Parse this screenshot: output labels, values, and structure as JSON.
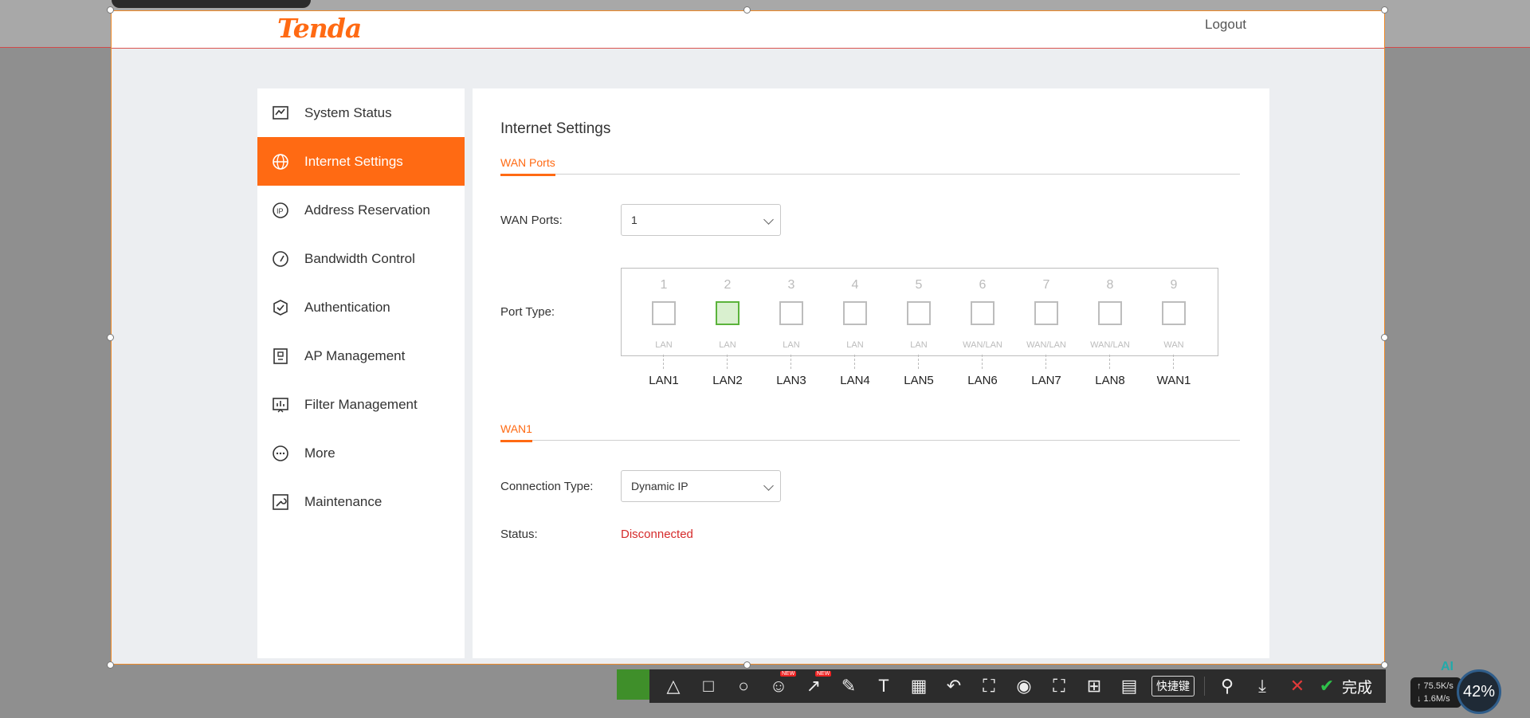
{
  "app": {
    "logo": "Tenda",
    "logout": "Logout"
  },
  "sidebar": {
    "items": [
      {
        "label": "System Status",
        "icon": "chart-icon"
      },
      {
        "label": "Internet Settings",
        "icon": "globe-icon",
        "active": true
      },
      {
        "label": "Address Reservation",
        "icon": "ip-icon"
      },
      {
        "label": "Bandwidth Control",
        "icon": "gauge-icon"
      },
      {
        "label": "Authentication",
        "icon": "shield-check-icon"
      },
      {
        "label": "AP Management",
        "icon": "ap-icon"
      },
      {
        "label": "Filter Management",
        "icon": "filter-chart-icon"
      },
      {
        "label": "More",
        "icon": "more-icon"
      },
      {
        "label": "Maintenance",
        "icon": "wrench-icon"
      }
    ]
  },
  "main": {
    "title": "Internet Settings",
    "wan_tab": "WAN Ports",
    "wan_ports_label": "WAN Ports:",
    "wan_ports_value": "1",
    "port_type_label": "Port Type:",
    "ports": [
      {
        "num": "1",
        "type": "LAN",
        "label": "LAN1",
        "active": false
      },
      {
        "num": "2",
        "type": "LAN",
        "label": "LAN2",
        "active": true
      },
      {
        "num": "3",
        "type": "LAN",
        "label": "LAN3",
        "active": false
      },
      {
        "num": "4",
        "type": "LAN",
        "label": "LAN4",
        "active": false
      },
      {
        "num": "5",
        "type": "LAN",
        "label": "LAN5",
        "active": false
      },
      {
        "num": "6",
        "type": "WAN/LAN",
        "label": "LAN6",
        "active": false
      },
      {
        "num": "7",
        "type": "WAN/LAN",
        "label": "LAN7",
        "active": false
      },
      {
        "num": "8",
        "type": "WAN/LAN",
        "label": "LAN8",
        "active": false
      },
      {
        "num": "9",
        "type": "WAN",
        "label": "WAN1",
        "active": false
      }
    ],
    "wan1_tab": "WAN1",
    "connection_type_label": "Connection Type:",
    "connection_type_value": "Dynamic IP",
    "status_label": "Status:",
    "status_value": "Disconnected"
  },
  "toolbar": {
    "new_badge": "NEW",
    "shortcut_label": "快捷键",
    "done_label": "完成"
  },
  "netmon": {
    "ai": "AI",
    "up": "↑ 75.5K/s",
    "down": "↓ 1.6M/s",
    "percent": "42%"
  },
  "colors": {
    "accent": "#ff6a13",
    "active_port": "#5bb33b",
    "status_error": "#d52b2b"
  }
}
